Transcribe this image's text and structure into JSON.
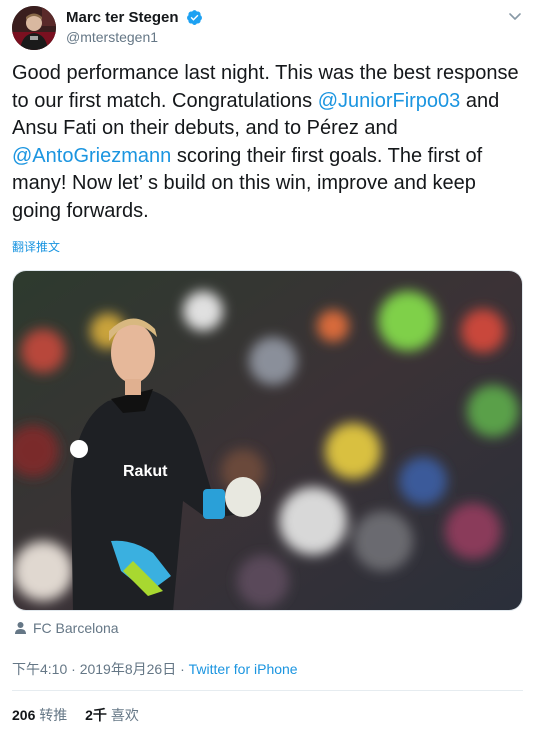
{
  "author": {
    "display_name": "Marc ter Stegen",
    "handle": "@mterstegen1"
  },
  "tweet": {
    "segments": [
      {
        "text": "Good performance last night. This was the best response to our first match. Congratulations ",
        "type": "text"
      },
      {
        "text": "@JuniorFirpo03",
        "type": "mention"
      },
      {
        "text": " and Ansu Fati on their debuts, and to Pérez and ",
        "type": "text"
      },
      {
        "text": "@AntoGriezmann",
        "type": "mention"
      },
      {
        "text": " scoring their first goals. The first of many! Now let’ s build on this win, improve and keep going forwards.",
        "type": "text"
      }
    ],
    "translate_label": "翻译推文"
  },
  "media": {
    "tagged_user": "FC Barcelona"
  },
  "meta": {
    "timestamp": "下午4:10 · 2019年8月26日",
    "separator": " · ",
    "source": "Twitter for iPhone"
  },
  "stats": {
    "retweets_count": "206",
    "retweets_label": "转推",
    "likes_count": "2千",
    "likes_label": "喜欢"
  },
  "colors": {
    "link": "#1b95e0",
    "secondary_text": "#657786",
    "primary_text": "#14171a",
    "verified": "#1da1f2"
  },
  "icons": {
    "verified": "verified-badge-icon",
    "caret": "chevron-down-icon",
    "tag": "person-tag-icon"
  }
}
